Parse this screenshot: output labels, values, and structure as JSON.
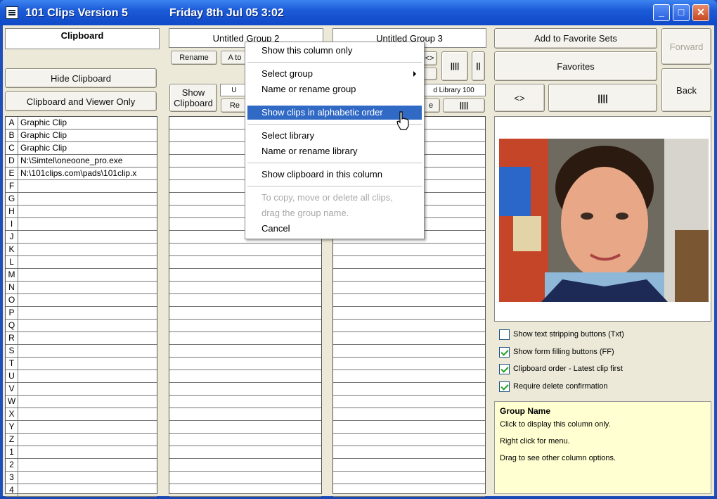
{
  "window": {
    "app_title": "101 Clips Version 5",
    "datetime": "Friday  8th Jul 05   3:02",
    "minimize_icon": "minimize-icon",
    "maximize_icon": "maximize-icon",
    "close_icon": "close-icon"
  },
  "clipboard_column": {
    "title": "Clipboard",
    "hide_button": "Hide Clipboard",
    "viewer_button": "Clipboard and Viewer Only",
    "keys": [
      "A",
      "B",
      "C",
      "D",
      "E",
      "F",
      "G",
      "H",
      "I",
      "J",
      "K",
      "L",
      "M",
      "N",
      "O",
      "P",
      "Q",
      "R",
      "S",
      "T",
      "U",
      "V",
      "W",
      "X",
      "Y",
      "Z",
      "1",
      "2",
      "3",
      "4"
    ],
    "clips": [
      "Graphic Clip",
      "Graphic Clip",
      "Graphic Clip",
      "N:\\Simtel\\oneoone_pro.exe",
      "N:\\101clips.com\\pads\\101clip.x"
    ]
  },
  "group2": {
    "title": "Untitled Group 2",
    "rename_button": "Rename",
    "atoz_button": "A to",
    "show_clipboard_button": "Show Clipboard",
    "sub_label": "U",
    "re_button": "Re"
  },
  "group3": {
    "title": "Untitled Group 3",
    "arrows_button": "<>",
    "bars_button": "||||",
    "bar_button": "||",
    "library_label": "d Library 100",
    "e_button": "e",
    "bars2_button": "||||"
  },
  "right_panel": {
    "add_favorite_button": "Add to Favorite Sets",
    "forward_button": "Forward",
    "favorites_button": "Favorites",
    "back_button": "Back",
    "arrows_button": "<>",
    "bars_button": "||||",
    "checkboxes": [
      {
        "label": "Show text stripping buttons (Txt)",
        "checked": false
      },
      {
        "label": "Show form filling buttons (FF)",
        "checked": true
      },
      {
        "label": "Clipboard order - Latest clip first",
        "checked": true
      },
      {
        "label": "Require delete confirmation",
        "checked": true
      }
    ],
    "help": {
      "heading": "Group Name",
      "line1": "Click to display this column only.",
      "line2": "Right click for menu.",
      "line3": "Drag to see other column options."
    }
  },
  "context_menu": {
    "items": [
      {
        "label": "Show this column only"
      },
      {
        "label": "Select group"
      },
      {
        "label": "Name or rename group"
      },
      {
        "label": "Show clips in alphabetic order"
      },
      {
        "label": "Select library"
      },
      {
        "label": "Name or rename library"
      },
      {
        "label": "Show clipboard in this column"
      },
      {
        "label": "To copy, move or delete all clips,"
      },
      {
        "label": "drag the group name."
      },
      {
        "label": "Cancel"
      }
    ]
  },
  "colors": {
    "title_bar": "#1c5bd8",
    "menu_highlight": "#316ac5",
    "help_background": "#ffffd1"
  }
}
